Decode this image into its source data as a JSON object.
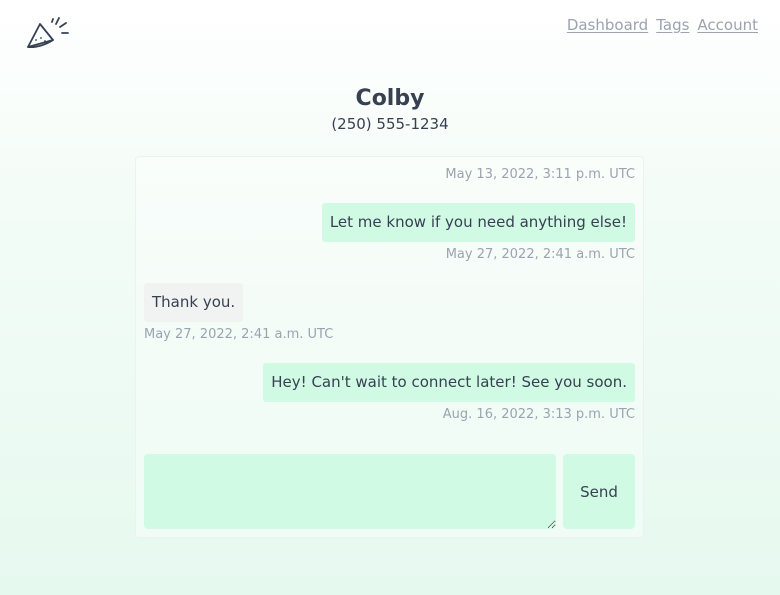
{
  "header": {
    "logo_icon": "party-popper-icon",
    "nav": {
      "dashboard": "Dashboard",
      "tags": "Tags",
      "account": "Account"
    }
  },
  "contact": {
    "name": "Colby",
    "phone": "(250) 555-1234"
  },
  "thread": {
    "items": [
      {
        "kind": "timestamp",
        "side": "right",
        "text": "May 13, 2022, 3:11 p.m. UTC"
      },
      {
        "kind": "message",
        "side": "right",
        "text": "Let me know if you need anything else!"
      },
      {
        "kind": "timestamp",
        "side": "right",
        "text": "May 27, 2022, 2:41 a.m. UTC"
      },
      {
        "kind": "message",
        "side": "left",
        "text": "Thank you."
      },
      {
        "kind": "timestamp",
        "side": "left",
        "text": "May 27, 2022, 2:41 a.m. UTC"
      },
      {
        "kind": "message",
        "side": "right",
        "text": "Hey! Can't wait to connect later! See you soon."
      },
      {
        "kind": "timestamp",
        "side": "right",
        "text": "Aug. 16, 2022, 3:13 p.m. UTC"
      }
    ]
  },
  "compose": {
    "value": "",
    "send_label": "Send"
  },
  "colors": {
    "outgoing_bubble": "#d1fae5",
    "incoming_bubble": "#f1f3f3",
    "timestamp": "#9ca3af",
    "text": "#374151"
  }
}
